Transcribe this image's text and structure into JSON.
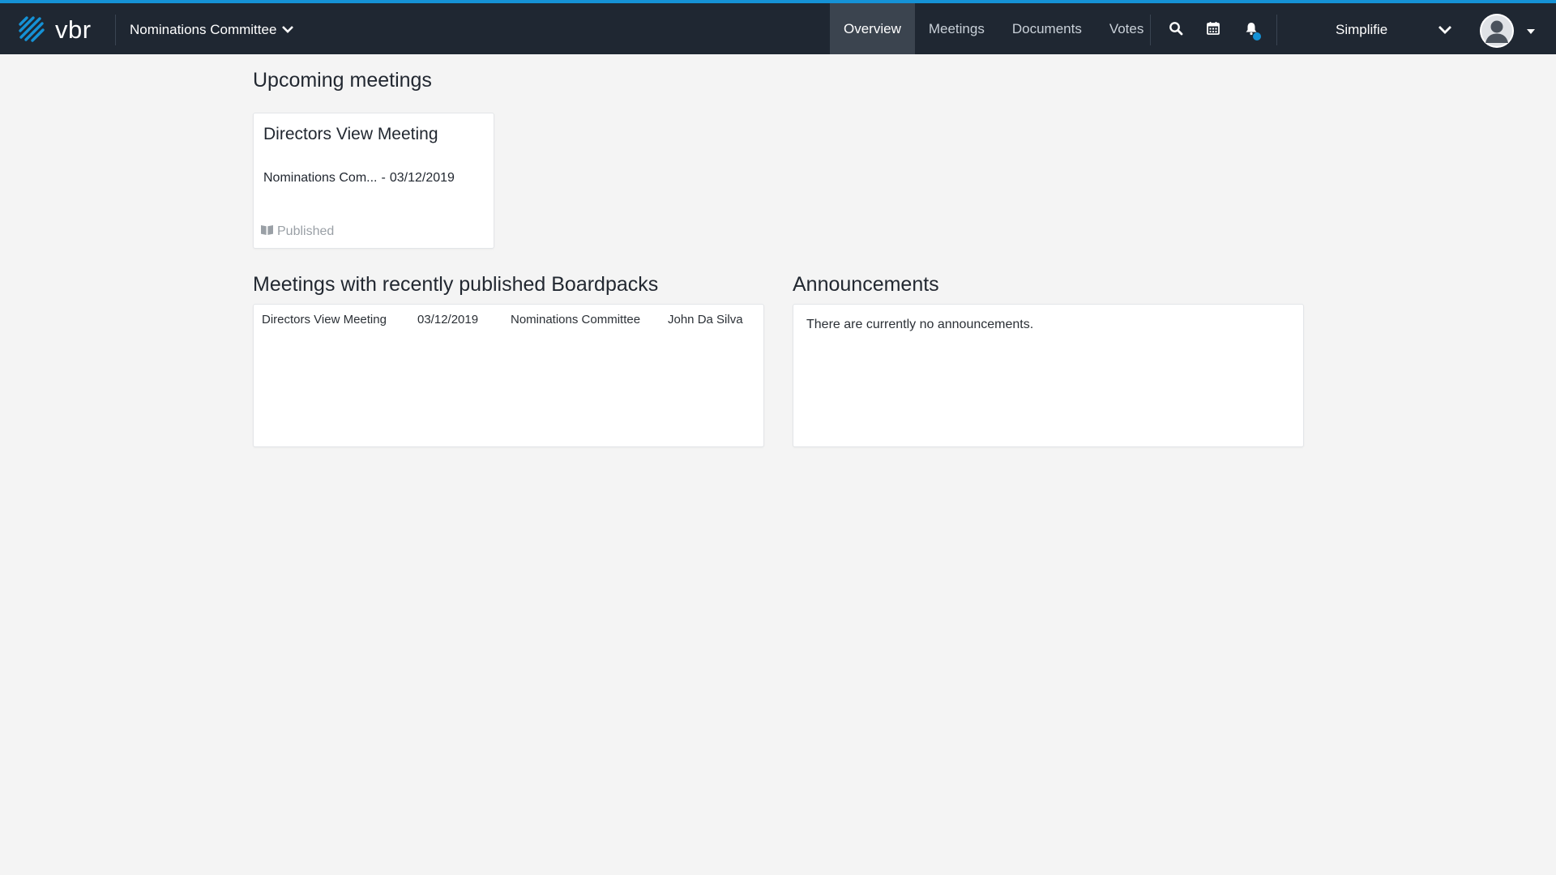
{
  "topbar": {
    "logo_text": "vbr",
    "committee": "Nominations Committee",
    "nav": [
      {
        "label": "Overview",
        "active": true
      },
      {
        "label": "Meetings",
        "active": false
      },
      {
        "label": "Documents",
        "active": false
      },
      {
        "label": "Votes",
        "active": false
      }
    ],
    "icons": [
      "search-icon",
      "calendar-icon",
      "bell-icon"
    ],
    "organisation": "Simplifie"
  },
  "upcoming": {
    "title": "Upcoming meetings",
    "meetings": [
      {
        "title": "Directors View Meeting",
        "committee": "Nominations Com...",
        "separator": "-",
        "date": "03/12/2019",
        "status": "Published"
      }
    ]
  },
  "boardpacks": {
    "title": "Meetings with recently published Boardpacks",
    "rows": [
      {
        "meeting": "Directors View Meeting",
        "date": "03/12/2019",
        "committee": "Nominations Committee",
        "author": "John Da Silva"
      }
    ]
  },
  "announcements": {
    "title": "Announcements",
    "empty_text": "There are currently no announcements."
  },
  "colors": {
    "accent": "#1592d6",
    "topbar_bg": "#1f2732",
    "page_bg": "#f4f4f4"
  }
}
